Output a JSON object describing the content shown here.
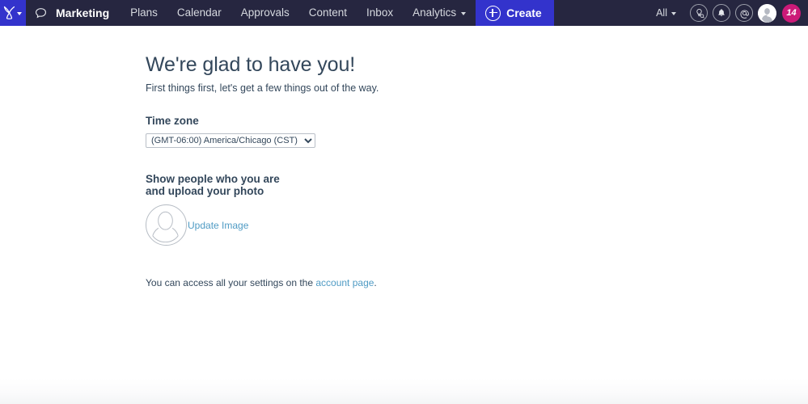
{
  "nav": {
    "logo_icon": "sprocket-logo-icon",
    "logo_caret_icon": "chevron-down-icon",
    "bubble_icon": "speech-bubble-icon",
    "brand": "Marketing",
    "items": [
      {
        "label": "Plans",
        "has_caret": false
      },
      {
        "label": "Calendar",
        "has_caret": false
      },
      {
        "label": "Approvals",
        "has_caret": false
      },
      {
        "label": "Content",
        "has_caret": false
      },
      {
        "label": "Inbox",
        "has_caret": false
      },
      {
        "label": "Analytics",
        "has_caret": true
      }
    ],
    "create_label": "Create",
    "create_icon": "plus-circle-icon",
    "filter_label": "All",
    "filter_caret_icon": "chevron-down-icon",
    "right_icons": [
      {
        "name": "bulb-search-icon"
      },
      {
        "name": "bell-icon"
      },
      {
        "name": "mentions-at-icon"
      }
    ],
    "avatar_icon": "user-avatar-icon",
    "badge_count": "14",
    "colors": {
      "navbar_bg": "#262640",
      "accent": "#3333cc",
      "badge": "#cc1a78",
      "nav_text": "#d6d9df"
    }
  },
  "main": {
    "title": "We're glad to have you!",
    "subtitle": "First things first, let's get a few things out of the way.",
    "timezone": {
      "label": "Time zone",
      "value": "(GMT-06:00) America/Chicago (CST)",
      "options": [
        "(GMT-06:00) America/Chicago (CST)"
      ]
    },
    "photo": {
      "label_line1": "Show people who you are",
      "label_line2": "and upload your photo",
      "avatar_icon": "user-silhouette-icon",
      "update_link": "Update Image"
    },
    "footnote": {
      "prefix": "You can access all your settings on the ",
      "link": "account page",
      "suffix": "."
    },
    "colors": {
      "text": "#33475b",
      "link": "#4f9bc4"
    }
  }
}
